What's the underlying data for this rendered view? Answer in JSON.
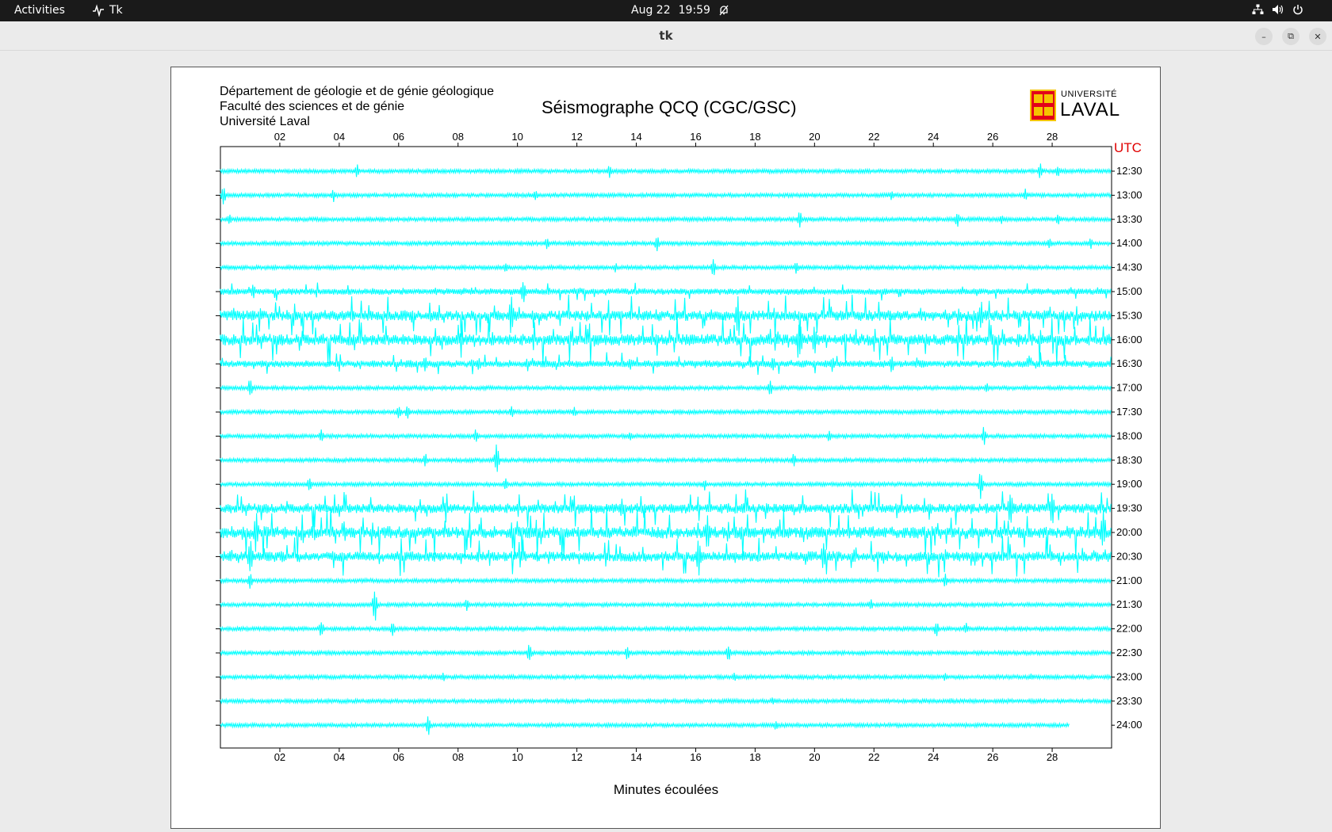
{
  "topbar": {
    "activities": "Activities",
    "app_name": "Tk",
    "date": "Aug 22",
    "time": "19:59"
  },
  "window": {
    "title": "tk"
  },
  "header": {
    "dept_line1": "Département de géologie et de génie géologique",
    "dept_line2": "Faculté des sciences et de génie",
    "dept_line3": "Université Laval",
    "title": "Séismographe QCQ (CGC/GSC)",
    "logo_top": "UNIVERSITÉ",
    "logo_main": "LAVAL"
  },
  "chart_data": {
    "type": "line",
    "title": "Séismographe QCQ (CGC/GSC)",
    "xlabel": "Minutes écoulées",
    "ylabel": "UTC",
    "xlim": [
      0,
      30
    ],
    "x_ticks": [
      "02",
      "04",
      "06",
      "08",
      "10",
      "12",
      "14",
      "16",
      "18",
      "20",
      "22",
      "24",
      "26",
      "28"
    ],
    "trace_color": "#00ffff",
    "rows": [
      {
        "label": "12:30",
        "activity": 0.15,
        "events": [
          [
            4.6,
            10
          ],
          [
            13.1,
            9
          ],
          [
            27.6,
            12
          ],
          [
            28.2,
            10
          ]
        ]
      },
      {
        "label": "13:00",
        "activity": 0.15,
        "events": [
          [
            0.1,
            14
          ],
          [
            3.8,
            10
          ],
          [
            10.6,
            9
          ],
          [
            22.6,
            8
          ],
          [
            27.1,
            9
          ]
        ]
      },
      {
        "label": "13:30",
        "activity": 0.15,
        "events": [
          [
            0.3,
            8
          ],
          [
            19.5,
            12
          ],
          [
            24.8,
            12
          ],
          [
            26.3,
            7
          ],
          [
            28.2,
            10
          ]
        ]
      },
      {
        "label": "14:00",
        "activity": 0.15,
        "events": [
          [
            11.0,
            9
          ],
          [
            14.7,
            11
          ],
          [
            27.9,
            8
          ],
          [
            29.3,
            8
          ]
        ]
      },
      {
        "label": "14:30",
        "activity": 0.15,
        "events": [
          [
            9.6,
            9
          ],
          [
            13.3,
            7
          ],
          [
            16.6,
            13
          ],
          [
            19.4,
            10
          ]
        ]
      },
      {
        "label": "15:00",
        "activity": 0.6,
        "events": [
          [
            1.1,
            12
          ],
          [
            2.4,
            6
          ],
          [
            10.2,
            18
          ]
        ]
      },
      {
        "label": "15:30",
        "activity": 1.6,
        "events": [
          [
            9.8,
            30
          ],
          [
            17.4,
            25
          ],
          [
            25.6,
            25
          ]
        ]
      },
      {
        "label": "16:00",
        "activity": 1.8,
        "events": [
          [
            19.5,
            30
          ],
          [
            20.0,
            28
          ]
        ]
      },
      {
        "label": "16:30",
        "activity": 0.8,
        "events": [
          [
            6.9,
            12
          ],
          [
            8.7,
            10
          ],
          [
            13.8,
            12
          ],
          [
            18.6,
            14
          ],
          [
            20.6,
            12
          ],
          [
            22.6,
            14
          ]
        ]
      },
      {
        "label": "17:00",
        "activity": 0.2,
        "events": [
          [
            1.0,
            14
          ],
          [
            18.5,
            12
          ],
          [
            25.8,
            9
          ]
        ]
      },
      {
        "label": "17:30",
        "activity": 0.15,
        "events": [
          [
            6.0,
            11
          ],
          [
            6.3,
            12
          ],
          [
            9.8,
            9
          ],
          [
            11.9,
            8
          ]
        ]
      },
      {
        "label": "18:00",
        "activity": 0.15,
        "events": [
          [
            3.4,
            10
          ],
          [
            8.6,
            12
          ],
          [
            13.8,
            8
          ],
          [
            20.5,
            9
          ],
          [
            25.7,
            14
          ]
        ]
      },
      {
        "label": "18:30",
        "activity": 0.15,
        "events": [
          [
            6.9,
            10
          ],
          [
            9.3,
            22
          ],
          [
            19.3,
            10
          ]
        ]
      },
      {
        "label": "19:00",
        "activity": 0.35,
        "events": [
          [
            3.0,
            10
          ],
          [
            9.6,
            10
          ],
          [
            16.3,
            8
          ],
          [
            25.6,
            20
          ]
        ]
      },
      {
        "label": "19:30",
        "activity": 1.4,
        "events": [
          [
            13.5,
            15
          ],
          [
            26.6,
            30
          ],
          [
            28.0,
            25
          ]
        ]
      },
      {
        "label": "20:00",
        "activity": 1.9,
        "events": [
          [
            1.2,
            30
          ],
          [
            16.4,
            25
          ],
          [
            29.7,
            25
          ]
        ]
      },
      {
        "label": "20:30",
        "activity": 1.5,
        "events": [
          [
            1.0,
            30
          ],
          [
            16.1,
            28
          ],
          [
            20.3,
            22
          ]
        ]
      },
      {
        "label": "21:00",
        "activity": 0.3,
        "events": [
          [
            1.0,
            14
          ],
          [
            24.4,
            10
          ]
        ]
      },
      {
        "label": "21:30",
        "activity": 0.15,
        "events": [
          [
            5.2,
            24
          ],
          [
            8.3,
            9
          ],
          [
            21.9,
            8
          ]
        ]
      },
      {
        "label": "22:00",
        "activity": 0.15,
        "events": [
          [
            3.4,
            14
          ],
          [
            5.8,
            10
          ],
          [
            24.1,
            12
          ],
          [
            25.1,
            9
          ]
        ]
      },
      {
        "label": "22:30",
        "activity": 0.15,
        "events": [
          [
            10.4,
            13
          ],
          [
            13.7,
            11
          ],
          [
            17.1,
            13
          ]
        ]
      },
      {
        "label": "23:00",
        "activity": 0.12,
        "events": [
          [
            7.5,
            7
          ],
          [
            17.3,
            6
          ],
          [
            24.4,
            6
          ],
          [
            27.3,
            6
          ]
        ]
      },
      {
        "label": "23:30",
        "activity": 0.12,
        "events": [
          [
            18.6,
            6
          ],
          [
            24.6,
            5
          ]
        ]
      },
      {
        "label": "24:00",
        "activity": 0.12,
        "events": [
          [
            7.0,
            14
          ],
          [
            18.7,
            8
          ]
        ],
        "end": 28.6
      }
    ]
  }
}
